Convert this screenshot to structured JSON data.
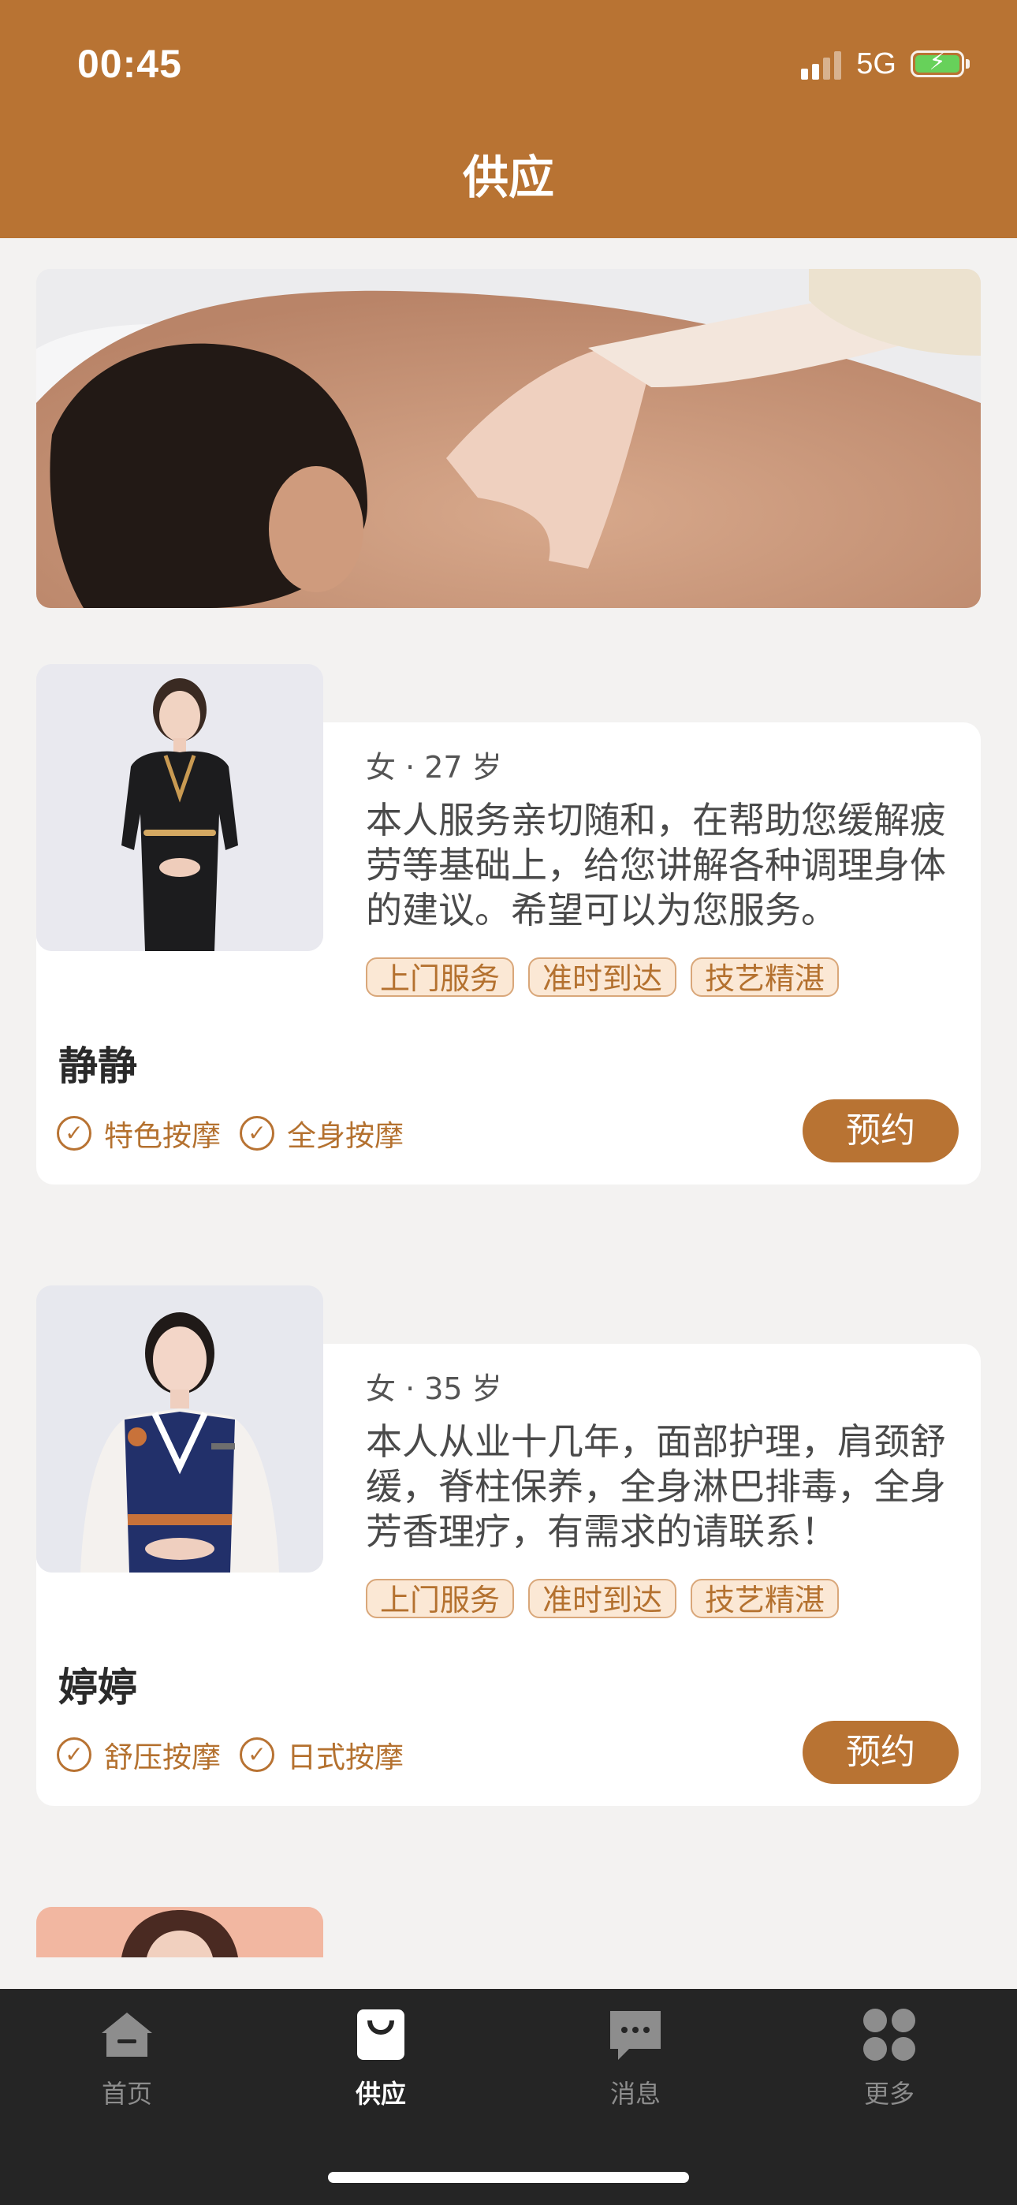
{
  "status_bar": {
    "time": "00:45",
    "network": "5G"
  },
  "header": {
    "title": "供应"
  },
  "providers": [
    {
      "meta": "女 · 27 岁",
      "description": "本人服务亲切随和，在帮助您缓解疲劳等基础上，给您讲解各种调理身体的建议。希望可以为您服务。",
      "tags": [
        "上门服务",
        "准时到达",
        "技艺精湛"
      ],
      "name": "静静",
      "services": [
        "特色按摩",
        "全身按摩"
      ],
      "book_label": "预约"
    },
    {
      "meta": "女 · 35 岁",
      "description": "本人从业十几年，面部护理，肩颈舒缓，脊柱保养，全身淋巴排毒，全身芳香理疗，有需求的请联系！",
      "tags": [
        "上门服务",
        "准时到达",
        "技艺精湛"
      ],
      "name": "婷婷",
      "services": [
        "舒压按摩",
        "日式按摩"
      ],
      "book_label": "预约"
    }
  ],
  "tabbar": {
    "items": [
      {
        "label": "首页",
        "icon": "home-icon"
      },
      {
        "label": "供应",
        "icon": "bag-icon",
        "active": true
      },
      {
        "label": "消息",
        "icon": "message-icon"
      },
      {
        "label": "更多",
        "icon": "more-icon"
      }
    ]
  },
  "colors": {
    "brand": "#b87333",
    "tag_bg": "#fbe8d5",
    "tabbar_bg": "#252525"
  }
}
